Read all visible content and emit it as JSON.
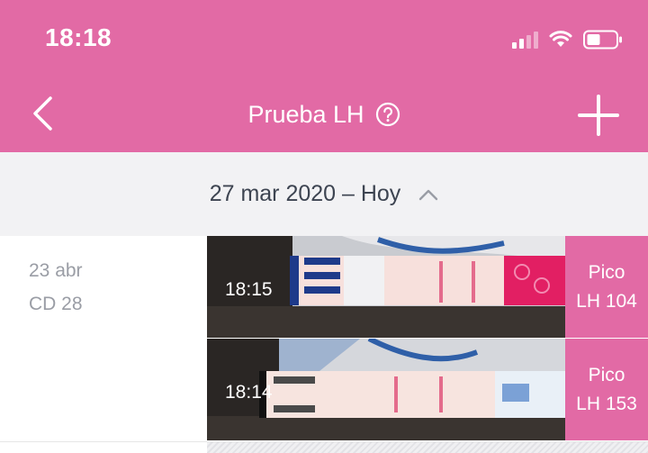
{
  "status_bar": {
    "time": "18:18"
  },
  "header": {
    "title": "Prueba LH"
  },
  "date_bar": {
    "label": "27 mar 2020 – Hoy"
  },
  "entry": {
    "date": "23 abr",
    "cycle_day": "CD 28",
    "tests": [
      {
        "time": "18:15",
        "result_label": "Pico",
        "result_value": "LH 104"
      },
      {
        "time": "18:14",
        "result_label": "Pico",
        "result_value": "LH 153"
      }
    ]
  },
  "colors": {
    "accent": "#e26aa5",
    "date_bar": "#f2f2f4",
    "text_muted": "#9a9da5"
  },
  "icons": [
    "back-arrow-icon",
    "help-icon",
    "plus-icon",
    "chevron-up-icon",
    "signal-icon",
    "wifi-icon",
    "battery-icon"
  ]
}
